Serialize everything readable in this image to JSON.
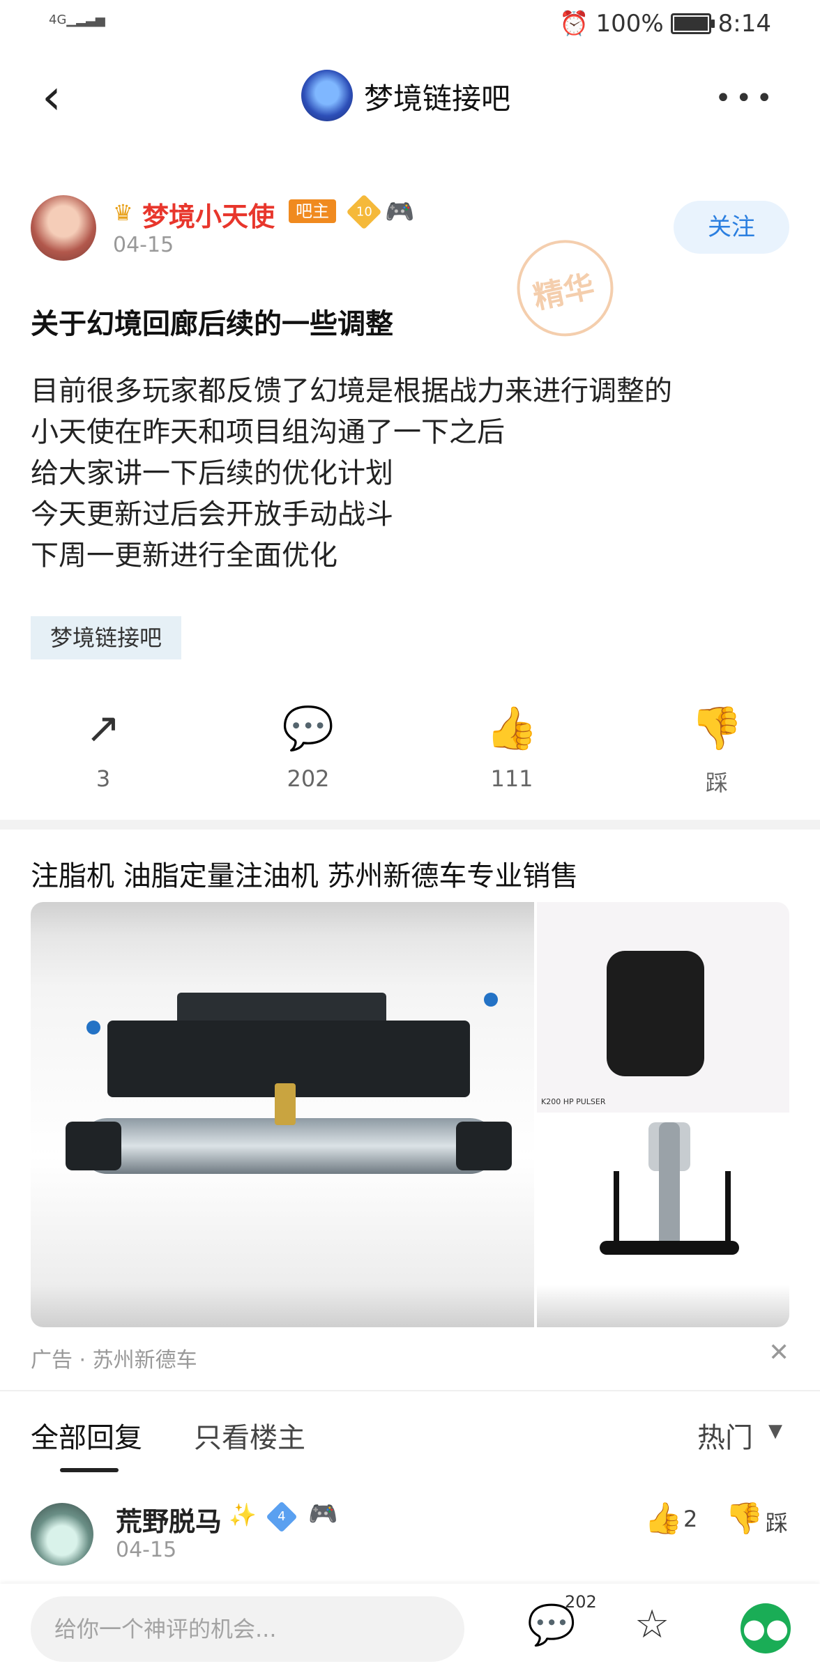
{
  "status_bar": {
    "signal": "4G",
    "battery": "100%",
    "time": "8:14",
    "alarm_icon": "alarm-icon"
  },
  "header": {
    "back_icon": "back-arrow-icon",
    "title": "梦境链接吧",
    "more_icon": "more-dots-icon"
  },
  "post": {
    "author": "梦境小天使",
    "owner_badge": "吧主",
    "level": "10",
    "date": "04-15",
    "follow_label": "关注",
    "badge_stamp": "精华",
    "title": "关于幻境回廊后续的一些调整",
    "body": [
      "目前很多玩家都反馈了幻境是根据战力来进行调整的",
      "小天使在昨天和项目组沟通了一下之后",
      "给大家讲一下后续的优化计划",
      "今天更新过后会开放手动战斗",
      "下周一更新进行全面优化"
    ],
    "tag": "梦境链接吧",
    "actions": {
      "share": {
        "icon": "share-icon",
        "label": "3"
      },
      "comment": {
        "icon": "comment-icon",
        "label": "202"
      },
      "like": {
        "icon": "thumbs-up-icon",
        "label": "111"
      },
      "dislike": {
        "icon": "thumbs-down-icon",
        "label": "踩"
      }
    }
  },
  "ad": {
    "title": "注脂机 油脂定量注油机 苏州新德车专业销售",
    "small_label": "K200 HP PULSER",
    "source": "广告 · 苏州新德车",
    "close_icon": "close-icon"
  },
  "replies_tabs": {
    "all": "全部回复",
    "owner_only": "只看楼主",
    "sort": "热门"
  },
  "reply": {
    "name": "荒野脱马",
    "level": "4",
    "date": "04-15",
    "like_count": "2",
    "dislike_label": "踩"
  },
  "bottom_bar": {
    "input_placeholder": "给你一个神评的机会...",
    "comment_count": "202",
    "accent_green": "#1aad56"
  }
}
